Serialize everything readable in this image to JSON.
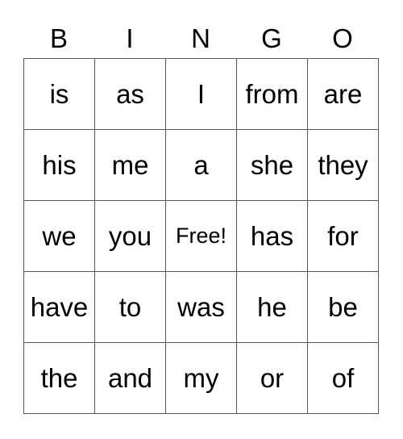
{
  "header": [
    "B",
    "I",
    "N",
    "G",
    "O"
  ],
  "rows": [
    [
      "is",
      "as",
      "I",
      "from",
      "are"
    ],
    [
      "his",
      "me",
      "a",
      "she",
      "they"
    ],
    [
      "we",
      "you",
      "Free!",
      "has",
      "for"
    ],
    [
      "have",
      "to",
      "was",
      "he",
      "be"
    ],
    [
      "the",
      "and",
      "my",
      "or",
      "of"
    ]
  ]
}
